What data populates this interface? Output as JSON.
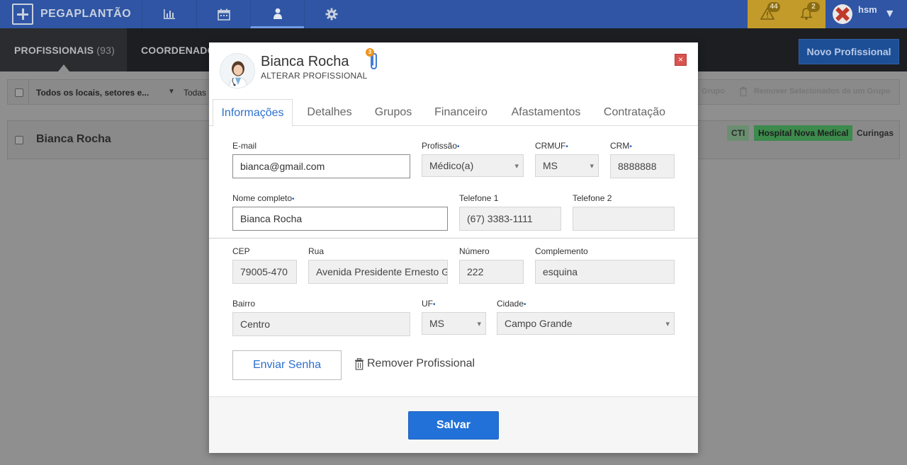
{
  "app": {
    "brand": "PEGAPLANTÃO"
  },
  "nav": {
    "icons": [
      "chart-icon",
      "calendar-icon",
      "user-icon",
      "gear-icon"
    ],
    "alert_count": "44",
    "notification_count": "2",
    "username": "hsm"
  },
  "subnav": {
    "tabs": [
      {
        "label": "PROFISSIONAIS",
        "count": "(93)"
      },
      {
        "label": "COORDENADO"
      }
    ],
    "new_button": "Novo Profissional"
  },
  "list": {
    "filter_location": "Todos os locais, setores e...",
    "filter_all": "Todas",
    "action_group": "Grupo",
    "action_remove": "Remover Selecionados de um Grupo",
    "rows": [
      {
        "name": "Bianca Rocha",
        "tags": [
          "CTI",
          "Hospital Nova Medical",
          "Curingas"
        ]
      }
    ]
  },
  "colors": {
    "accent": "#2271d8",
    "tag_green": "#3c8a4c",
    "nav_blue": "#2f55a4"
  },
  "modal": {
    "title": "Bianca Rocha",
    "subtitle": "ALTERAR PROFISSIONAL",
    "attachments": "3",
    "close": "×",
    "tabs": [
      "Informações",
      "Detalhes",
      "Grupos",
      "Financeiro",
      "Afastamentos",
      "Contratação"
    ],
    "fields": {
      "email": {
        "label": "E-mail",
        "value": "bianca@gmail.com"
      },
      "profissao": {
        "label": "Profissão",
        "value": "Médico(a)"
      },
      "crmuf": {
        "label": "CRMUF",
        "value": "MS"
      },
      "crm": {
        "label": "CRM",
        "value": "8888888"
      },
      "nome": {
        "label": "Nome completo",
        "value": "Bianca Rocha"
      },
      "tel1": {
        "label": "Telefone 1",
        "value": "(67) 3383-1111"
      },
      "tel2": {
        "label": "Telefone 2",
        "value": ""
      },
      "cep": {
        "label": "CEP",
        "value": "79005-470"
      },
      "rua": {
        "label": "Rua",
        "value": "Avenida Presidente Ernesto Geisel"
      },
      "numero": {
        "label": "Número",
        "value": "222"
      },
      "complemento": {
        "label": "Complemento",
        "value": "esquina"
      },
      "bairro": {
        "label": "Bairro",
        "value": "Centro"
      },
      "uf": {
        "label": "UF",
        "value": "MS"
      },
      "cidade": {
        "label": "Cidade",
        "value": "Campo Grande"
      }
    },
    "send_password": "Enviar Senha",
    "remove_professional": "Remover Profissional",
    "save": "Salvar"
  }
}
